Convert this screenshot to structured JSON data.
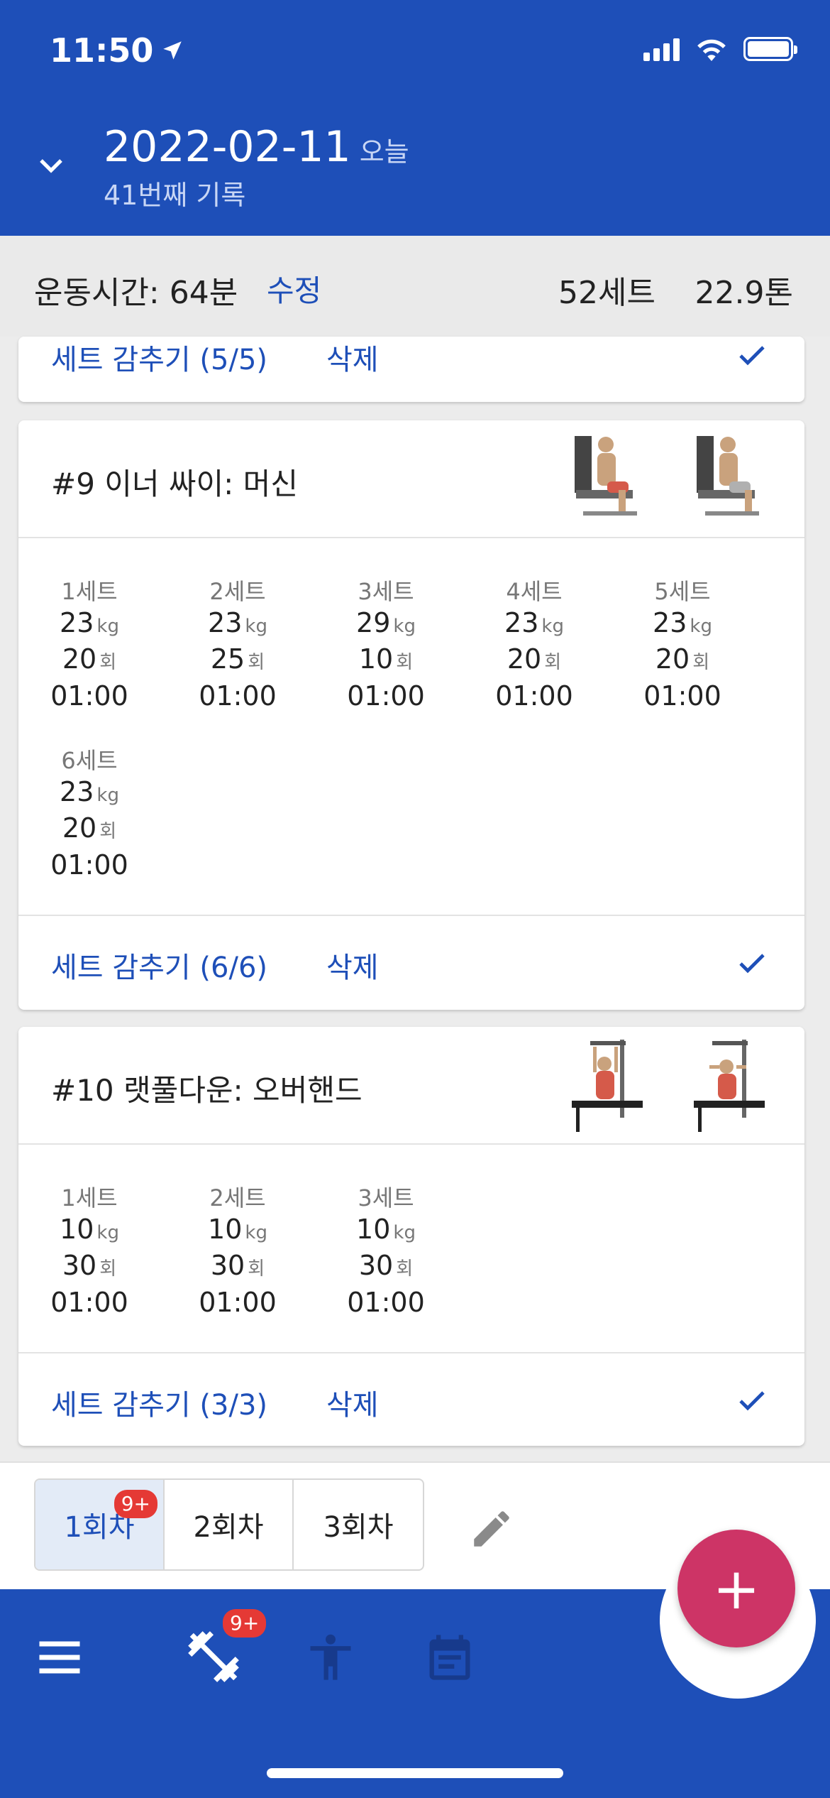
{
  "status": {
    "time": "11:50"
  },
  "header": {
    "date": "2022-02-11",
    "today": "오늘",
    "subtitle": "41번째 기록"
  },
  "summary": {
    "time_label": "운동시간: 64분",
    "edit_label": "수정",
    "sets_label": "52세트",
    "tons_label": "22.9톤"
  },
  "card_prev": {
    "hide_label": "세트 감추기 (5/5)",
    "delete_label": "삭제"
  },
  "card9": {
    "title": "#9 이너 싸이: 머신",
    "sets": [
      {
        "label": "1세트",
        "weight": "23",
        "reps": "20",
        "time": "01:00"
      },
      {
        "label": "2세트",
        "weight": "23",
        "reps": "25",
        "time": "01:00"
      },
      {
        "label": "3세트",
        "weight": "29",
        "reps": "10",
        "time": "01:00"
      },
      {
        "label": "4세트",
        "weight": "23",
        "reps": "20",
        "time": "01:00"
      },
      {
        "label": "5세트",
        "weight": "23",
        "reps": "20",
        "time": "01:00"
      },
      {
        "label": "6세트",
        "weight": "23",
        "reps": "20",
        "time": "01:00"
      }
    ],
    "hide_label": "세트 감추기 (6/6)",
    "delete_label": "삭제"
  },
  "card10": {
    "title": "#10 랫풀다운: 오버핸드",
    "sets": [
      {
        "label": "1세트",
        "weight": "10",
        "reps": "30",
        "time": "01:00"
      },
      {
        "label": "2세트",
        "weight": "10",
        "reps": "30",
        "time": "01:00"
      },
      {
        "label": "3세트",
        "weight": "10",
        "reps": "30",
        "time": "01:00"
      }
    ],
    "hide_label": "세트 감추기 (3/3)",
    "delete_label": "삭제"
  },
  "units": {
    "kg": "kg",
    "reps": "회"
  },
  "segments": {
    "items": [
      "1회차",
      "2회차",
      "3회차"
    ],
    "badge": "9+"
  },
  "nav": {
    "badge": "9+",
    "fab": "+"
  },
  "colors": {
    "primary": "#1e4fb8",
    "fab": "#cd3466",
    "badge": "#e53935"
  },
  "icons": [
    "chevron-down-icon",
    "check-icon",
    "pencil-icon",
    "menu-icon",
    "dumbbell-icon",
    "person-icon",
    "calendar-icon",
    "location-arrow-icon",
    "signal-icon",
    "wifi-icon",
    "battery-icon"
  ]
}
